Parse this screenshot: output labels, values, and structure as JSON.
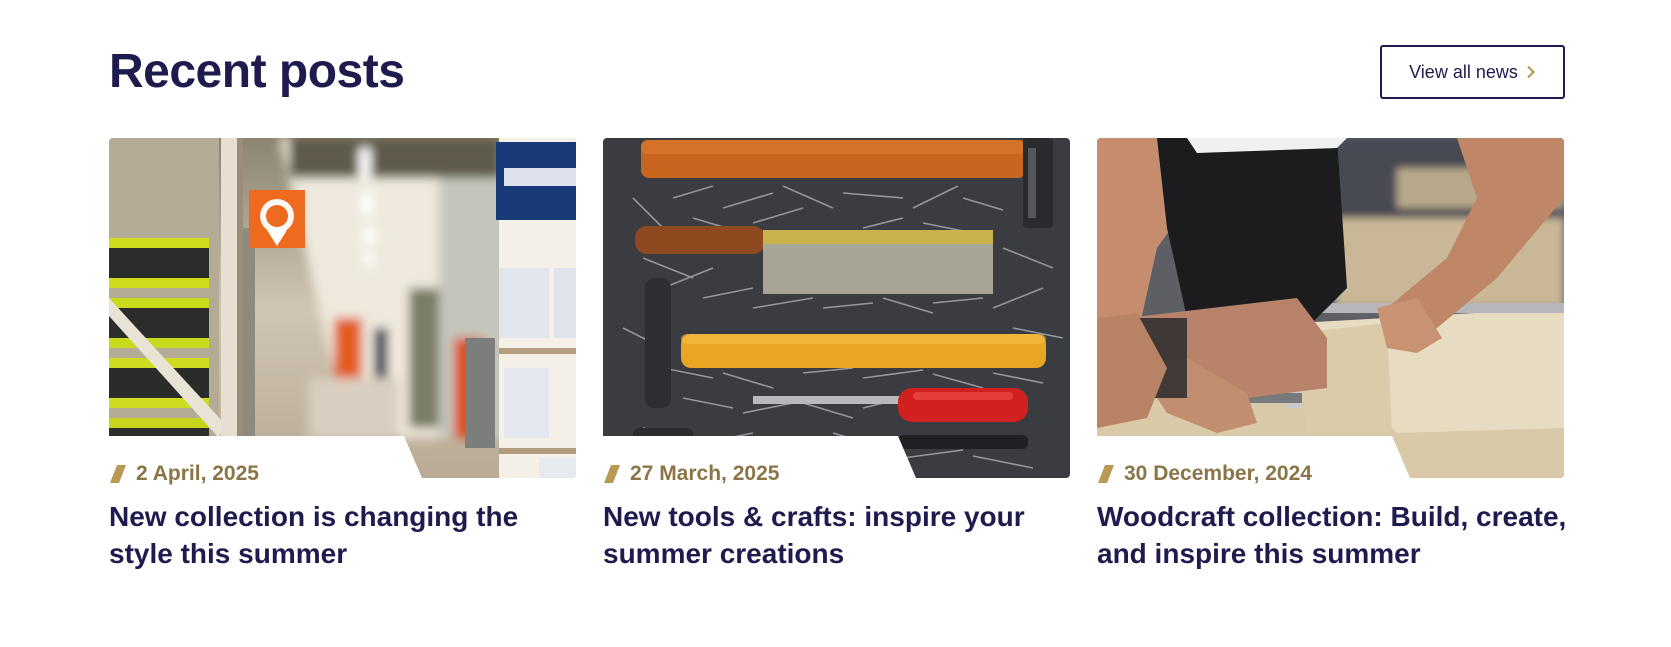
{
  "section": {
    "title": "Recent posts",
    "view_all_label": "View all news"
  },
  "colors": {
    "navy": "#1e1c4e",
    "gold": "#b89a52",
    "date_text": "#8b7547"
  },
  "icons": {
    "view_all": "chevron-right-icon",
    "date_marker": "slash-icon"
  },
  "posts": [
    {
      "date": "2 April, 2025",
      "title": "New collection is changing the style this summer",
      "image": "hardware-store-aisle"
    },
    {
      "date": "27 March, 2025",
      "title": "New tools & crafts: inspire your summer creations",
      "image": "tools-and-nails"
    },
    {
      "date": "30 December, 2024",
      "title": "Woodcraft collection: Build, create, and inspire this summer",
      "image": "woodworking-clamp"
    }
  ]
}
